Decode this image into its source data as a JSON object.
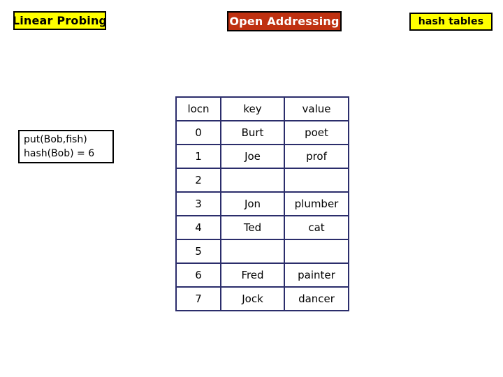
{
  "labels": {
    "topic_left": "Linear Probing",
    "topic_center": "Open Addressing",
    "topic_right": "hash tables"
  },
  "colors": {
    "chip_yellow_bg": "#ffff00",
    "chip_red_bg": "#bf3111",
    "chip_red_text": "#ffffff",
    "chip_border": "#000000",
    "table_border": "#2b2d6b",
    "text": "#000000",
    "page_bg": "#ffffff"
  },
  "operation": {
    "call_line": "put(Bob,fish)",
    "hash_line": "hash(Bob) = 6"
  },
  "table": {
    "headers": [
      "locn",
      "key",
      "value"
    ],
    "rows": [
      {
        "locn": "0",
        "key": "Burt",
        "value": "poet",
        "empty": false
      },
      {
        "locn": "1",
        "key": "Joe",
        "value": "prof",
        "empty": false
      },
      {
        "locn": "2",
        "key": "",
        "value": "",
        "empty": true
      },
      {
        "locn": "3",
        "key": "Jon",
        "value": "plumber",
        "empty": false
      },
      {
        "locn": "4",
        "key": "Ted",
        "value": "cat",
        "empty": false
      },
      {
        "locn": "5",
        "key": "",
        "value": "",
        "empty": true
      },
      {
        "locn": "6",
        "key": "Fred",
        "value": "painter",
        "empty": false
      },
      {
        "locn": "7",
        "key": "Jock",
        "value": "dancer",
        "empty": false
      }
    ]
  }
}
